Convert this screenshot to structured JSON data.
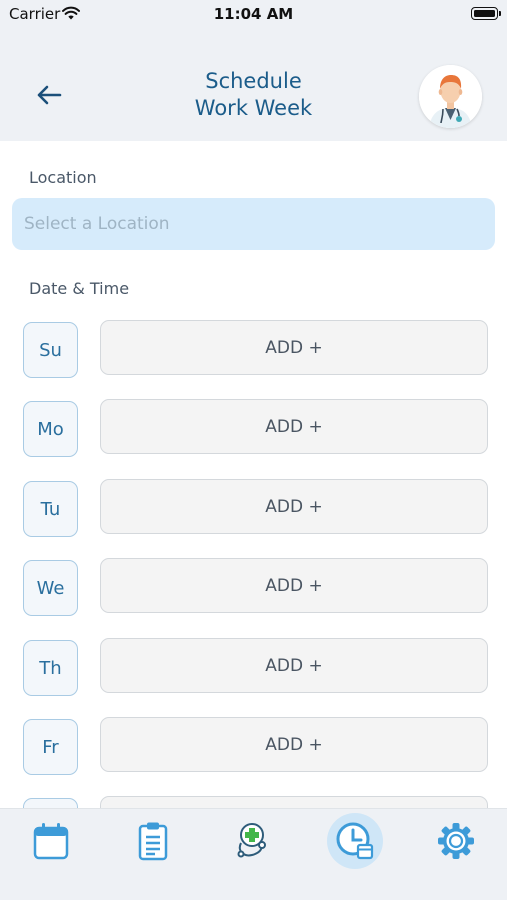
{
  "status_bar": {
    "carrier": "Carrier",
    "time": "11:04 AM"
  },
  "header": {
    "title_line1": "Schedule",
    "title_line2": "Work Week"
  },
  "location": {
    "label": "Location",
    "placeholder": "Select a Location"
  },
  "date_time": {
    "label": "Date & Time"
  },
  "days": [
    {
      "short": "Su",
      "action": "ADD +"
    },
    {
      "short": "Mo",
      "action": "ADD +"
    },
    {
      "short": "Tu",
      "action": "ADD +"
    },
    {
      "short": "We",
      "action": "ADD +"
    },
    {
      "short": "Th",
      "action": "ADD +"
    },
    {
      "short": "Fr",
      "action": "ADD +"
    },
    {
      "short": "",
      "action": ""
    }
  ],
  "tab_bar": {
    "active_index": 3,
    "items": [
      {
        "icon": "calendar-icon"
      },
      {
        "icon": "clipboard-icon"
      },
      {
        "icon": "stethoscope-icon"
      },
      {
        "icon": "clock-calendar-icon"
      },
      {
        "icon": "gear-icon"
      }
    ]
  },
  "colors": {
    "accent": "#1b5c8a",
    "header_bg": "#eef1f5",
    "input_bg": "#d6ebfb",
    "icon_blue": "#3d9bd8"
  }
}
